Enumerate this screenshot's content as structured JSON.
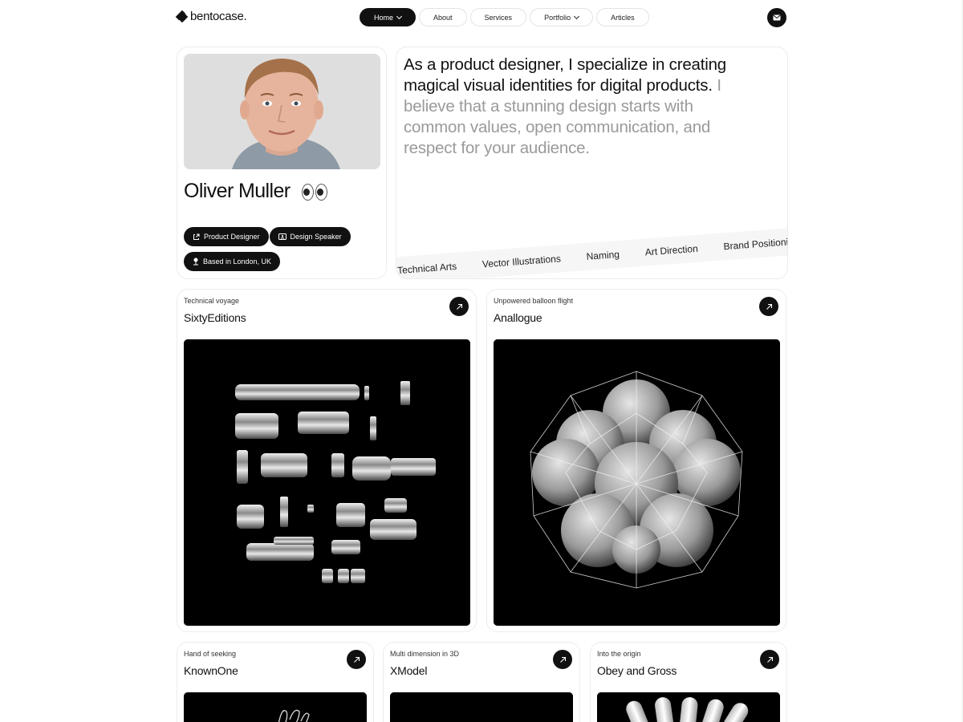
{
  "nav": {
    "logo": "bentocase.",
    "items": [
      {
        "label": "Home",
        "active": true,
        "dropdown": true
      },
      {
        "label": "About",
        "active": false,
        "dropdown": false
      },
      {
        "label": "Services",
        "active": false,
        "dropdown": false
      },
      {
        "label": "Portfolio",
        "active": false,
        "dropdown": true
      },
      {
        "label": "Articles",
        "active": false,
        "dropdown": false
      }
    ],
    "contact_icon": "mail-icon"
  },
  "profile": {
    "name": "Oliver Muller",
    "name_emoji": "eyes-emoji",
    "chips": [
      {
        "label": "Product Designer",
        "icon": "share-icon"
      },
      {
        "label": "Design Speaker",
        "icon": "presentation-icon"
      },
      {
        "label": "Based in London, UK",
        "icon": "location-pin-icon"
      }
    ]
  },
  "bio": {
    "headline": "As a product designer, I specialize in creating magical visual identities for digital products.",
    "body": " I believe that a stunning design starts with common values, open communication, and respect for your audience.",
    "skills": [
      "Technical Arts",
      "Vector Illustrations",
      "Naming",
      "Art Direction",
      "Brand Positioni"
    ]
  },
  "projects": [
    {
      "eyebrow": "Technical voyage",
      "title": "SixtyEditions"
    },
    {
      "eyebrow": "Unpowered balloon flight",
      "title": "Anallogue"
    },
    {
      "eyebrow": "Hand of seeking",
      "title": "KnownOne"
    },
    {
      "eyebrow": "Multi dimension in 3D",
      "title": "XModel"
    },
    {
      "eyebrow": "Into the origin",
      "title": "Obey and Gross"
    }
  ],
  "colors": {
    "accent": "#111111",
    "muted_text": "#9a9a9a",
    "card_border": "#ececec"
  }
}
